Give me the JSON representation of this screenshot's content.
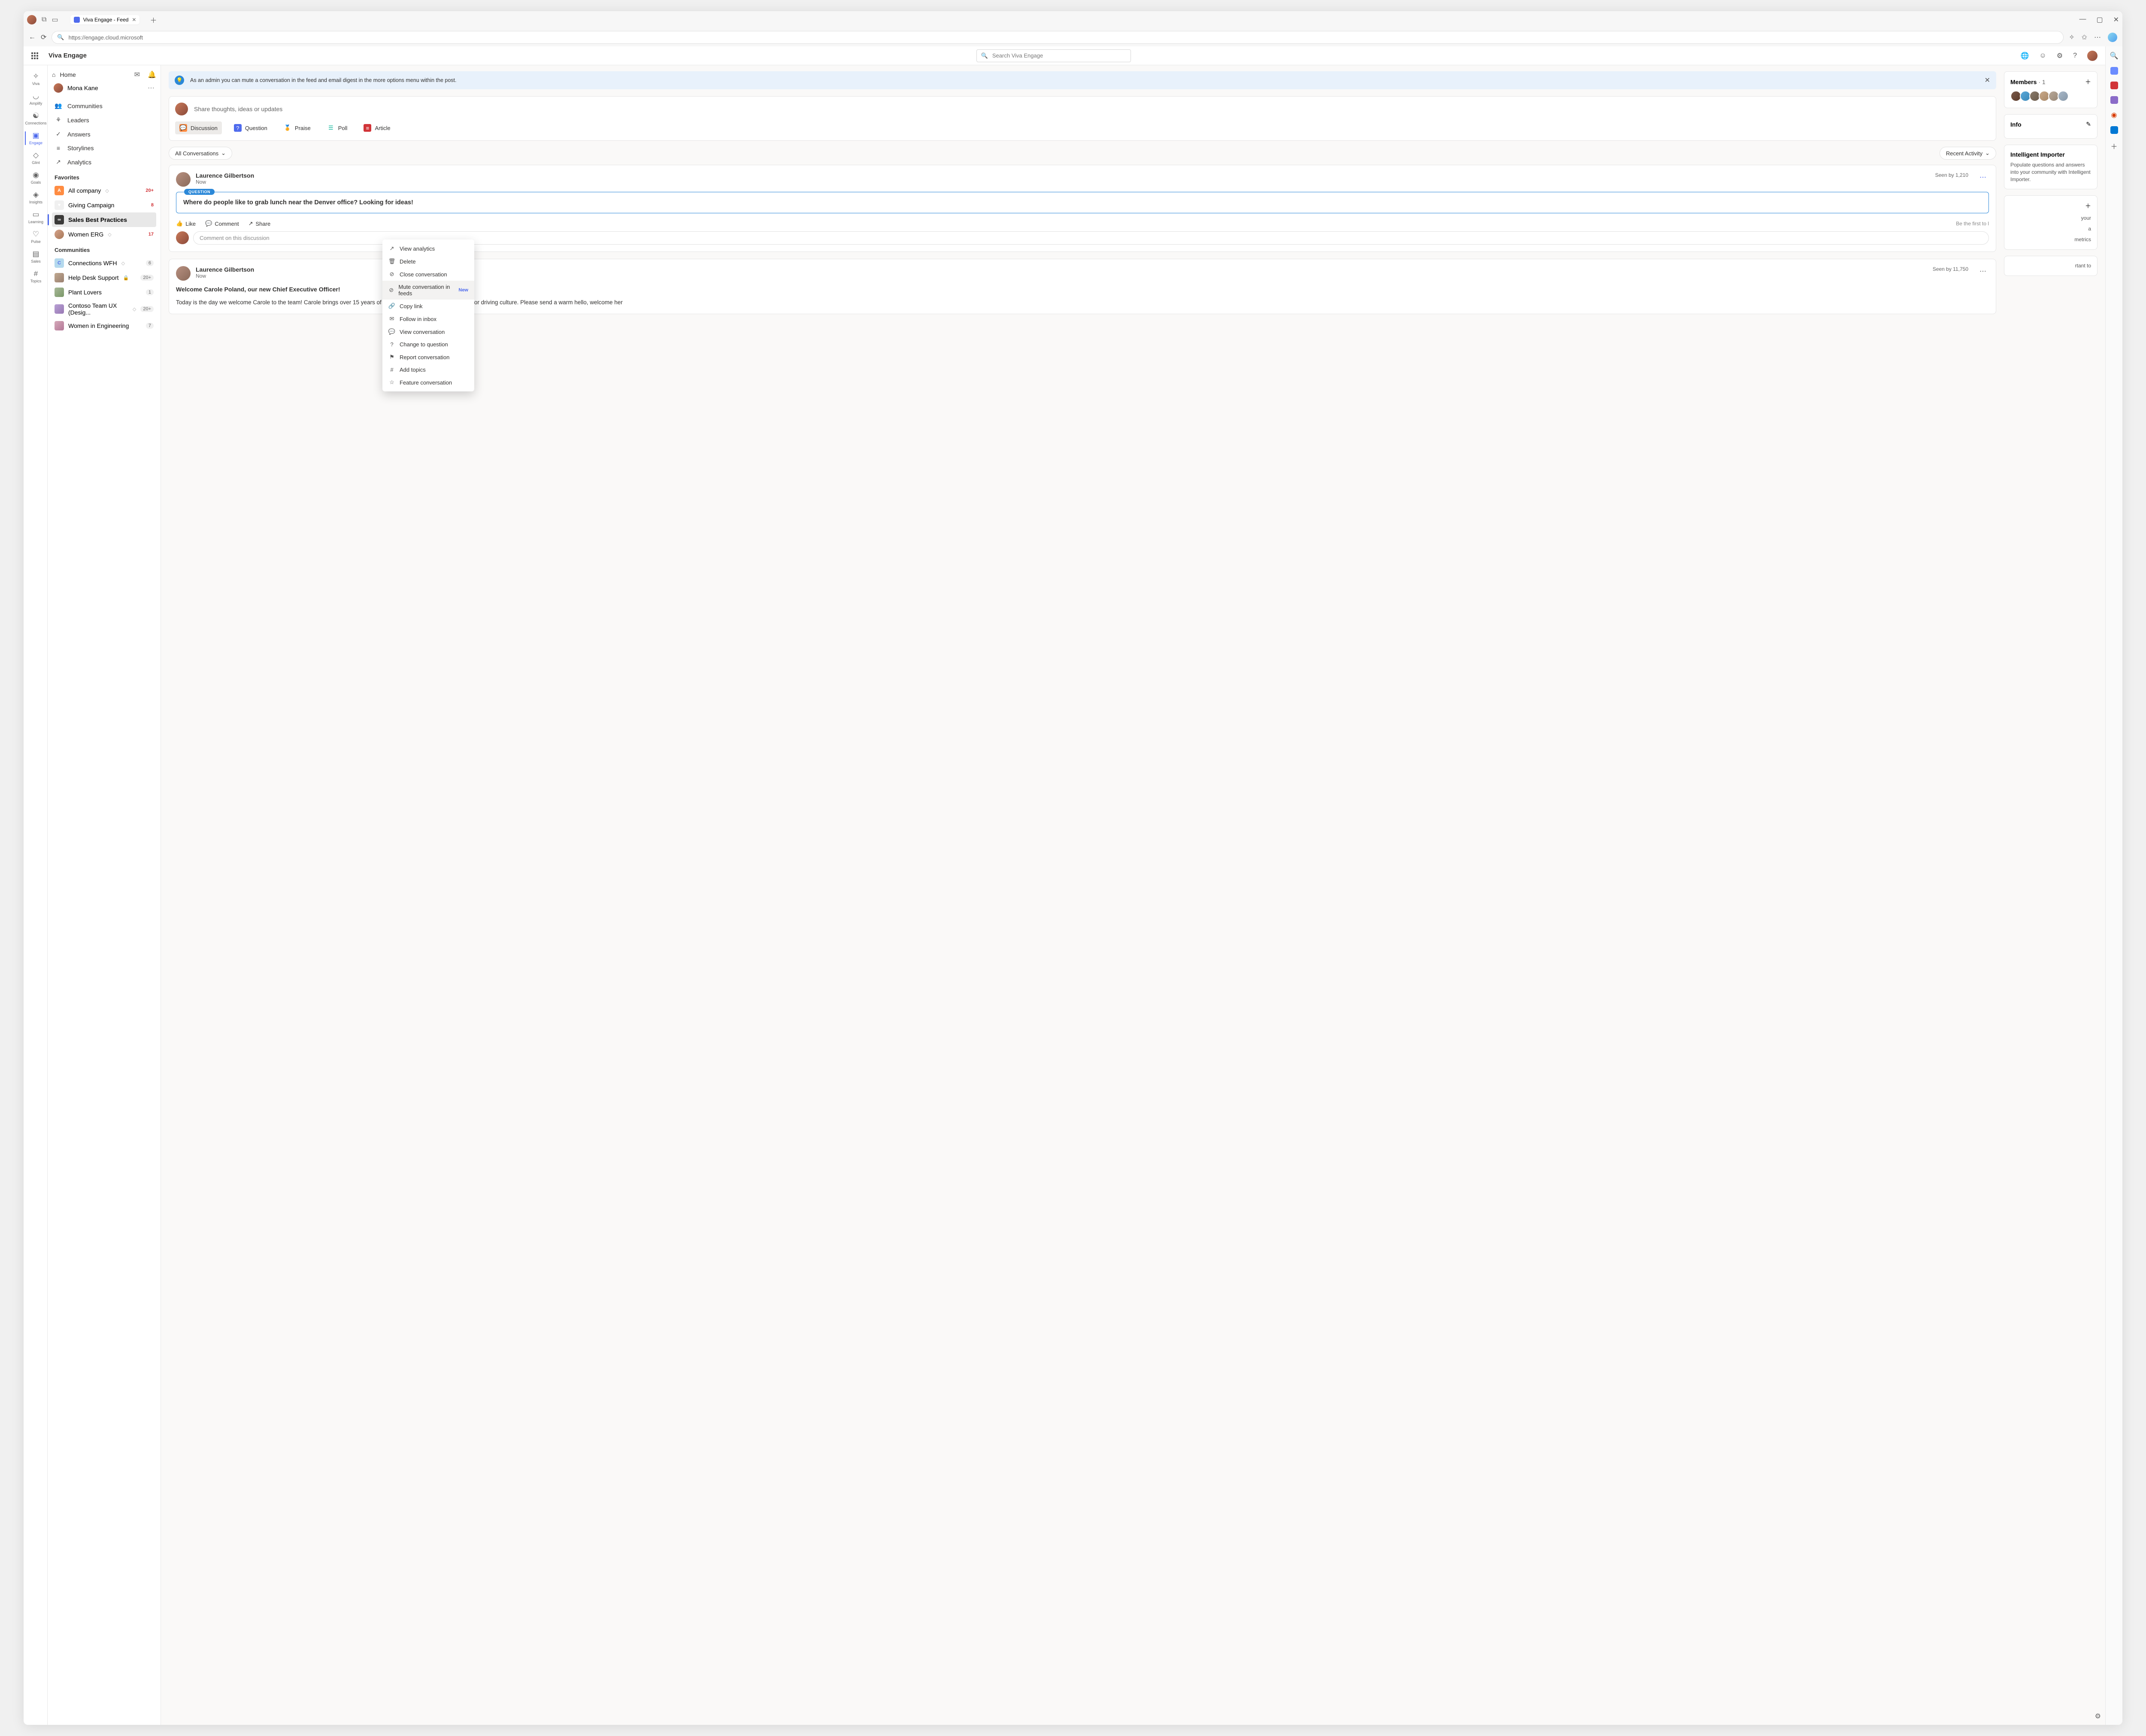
{
  "browser": {
    "tab_title": "Viva Engage - Feed",
    "url": "https://engage.cloud.microsoft"
  },
  "app": {
    "name": "Viva Engage",
    "search_placeholder": "Search Viva Engage"
  },
  "rail": [
    {
      "label": "Viva"
    },
    {
      "label": "Amplify"
    },
    {
      "label": "Connections"
    },
    {
      "label": "Engage"
    },
    {
      "label": "Glint"
    },
    {
      "label": "Goals"
    },
    {
      "label": "Insights"
    },
    {
      "label": "Learning"
    },
    {
      "label": "Pulse"
    },
    {
      "label": "Sales"
    },
    {
      "label": "Topics"
    }
  ],
  "nav": {
    "home": "Home",
    "user_name": "Mona Kane",
    "items": [
      {
        "label": "Communities"
      },
      {
        "label": "Leaders"
      },
      {
        "label": "Answers"
      },
      {
        "label": "Storylines"
      },
      {
        "label": "Analytics"
      }
    ],
    "favorites_heading": "Favorites",
    "favorites": [
      {
        "label": "All company",
        "badge": "20+",
        "color": "#ff8c42"
      },
      {
        "label": "Giving Campaign",
        "badge": "8",
        "color": "#e8e8e8"
      },
      {
        "label": "Sales Best Practices",
        "badge": "",
        "color": "#3b3a39"
      },
      {
        "label": "Women ERG",
        "badge": "17",
        "color": "#d4a28a"
      }
    ],
    "communities_heading": "Communities",
    "communities": [
      {
        "label": "Connections WFH",
        "badge": "6",
        "color": "#b4d9ed"
      },
      {
        "label": "Help Desk Support",
        "badge": "20+",
        "color": "#c0a890"
      },
      {
        "label": "Plant Lovers",
        "badge": "1",
        "color": "#a8b898"
      },
      {
        "label": "Contoso Team UX (Desig...",
        "badge": "20+",
        "color": "#b8a0d4"
      },
      {
        "label": "Women in Engineering",
        "badge": "7",
        "color": "#d4a8b8"
      }
    ]
  },
  "banner": "As an admin you can mute a conversation in the feed and email digest in the more options menu within the post.",
  "composer": {
    "placeholder": "Share thoughts, ideas or updates",
    "tabs": [
      {
        "label": "Discussion",
        "color": "#ff8c42"
      },
      {
        "label": "Question",
        "color": "#4f6bed"
      },
      {
        "label": "Praise",
        "color": "#e3008c"
      },
      {
        "label": "Poll",
        "color": "#00b294"
      },
      {
        "label": "Article",
        "color": "#d13438"
      }
    ]
  },
  "filters": {
    "left": "All Conversations",
    "right": "Recent Activity"
  },
  "posts": [
    {
      "author": "Laurence Gilbertson",
      "time": "Now",
      "seen": "Seen by 1,210",
      "tag": "QUESTION",
      "question": "Where do people like to grab lunch near the Denver office? Looking for ideas!",
      "like": "Like",
      "comment": "Comment",
      "share": "Share",
      "first_like": "Be the first to l",
      "comment_placeholder": "Comment on this discussion"
    },
    {
      "author": "Laurence Gilbertson",
      "time": "Now",
      "seen": "Seen by 11,750",
      "headline": "Welcome Carole Poland, our new Chief Executive Officer!",
      "body": "Today is the day we welcome Carole to the team! Carole brings over 15 years of industry experience and a passion for driving culture. Please send a warm hello, welcome her"
    }
  ],
  "dropdown": [
    {
      "label": "View analytics",
      "icon": "↗"
    },
    {
      "label": "Delete",
      "icon": "🗑"
    },
    {
      "label": "Close conversation",
      "icon": "⊘"
    },
    {
      "label": "Mute conversation in feeds",
      "icon": "⊘",
      "badge": "New"
    },
    {
      "label": "Copy link",
      "icon": "🔗"
    },
    {
      "label": "Follow in inbox",
      "icon": "✉"
    },
    {
      "label": "View conversation",
      "icon": "💬"
    },
    {
      "label": "Change to question",
      "icon": "?"
    },
    {
      "label": "Report conversation",
      "icon": "⚑"
    },
    {
      "label": "Add topics",
      "icon": "#"
    },
    {
      "label": "Feature conversation",
      "icon": "☆"
    }
  ],
  "right_panel": {
    "members": {
      "title": "Members",
      "count": "1"
    },
    "info": "Info",
    "importer": {
      "title": "Intelligent Importer",
      "text": "Populate questions and answers into your community with Intelligent Importer."
    },
    "frag1": "your",
    "frag2": "a",
    "frag3": "metrics",
    "frag4": "rtant to"
  }
}
